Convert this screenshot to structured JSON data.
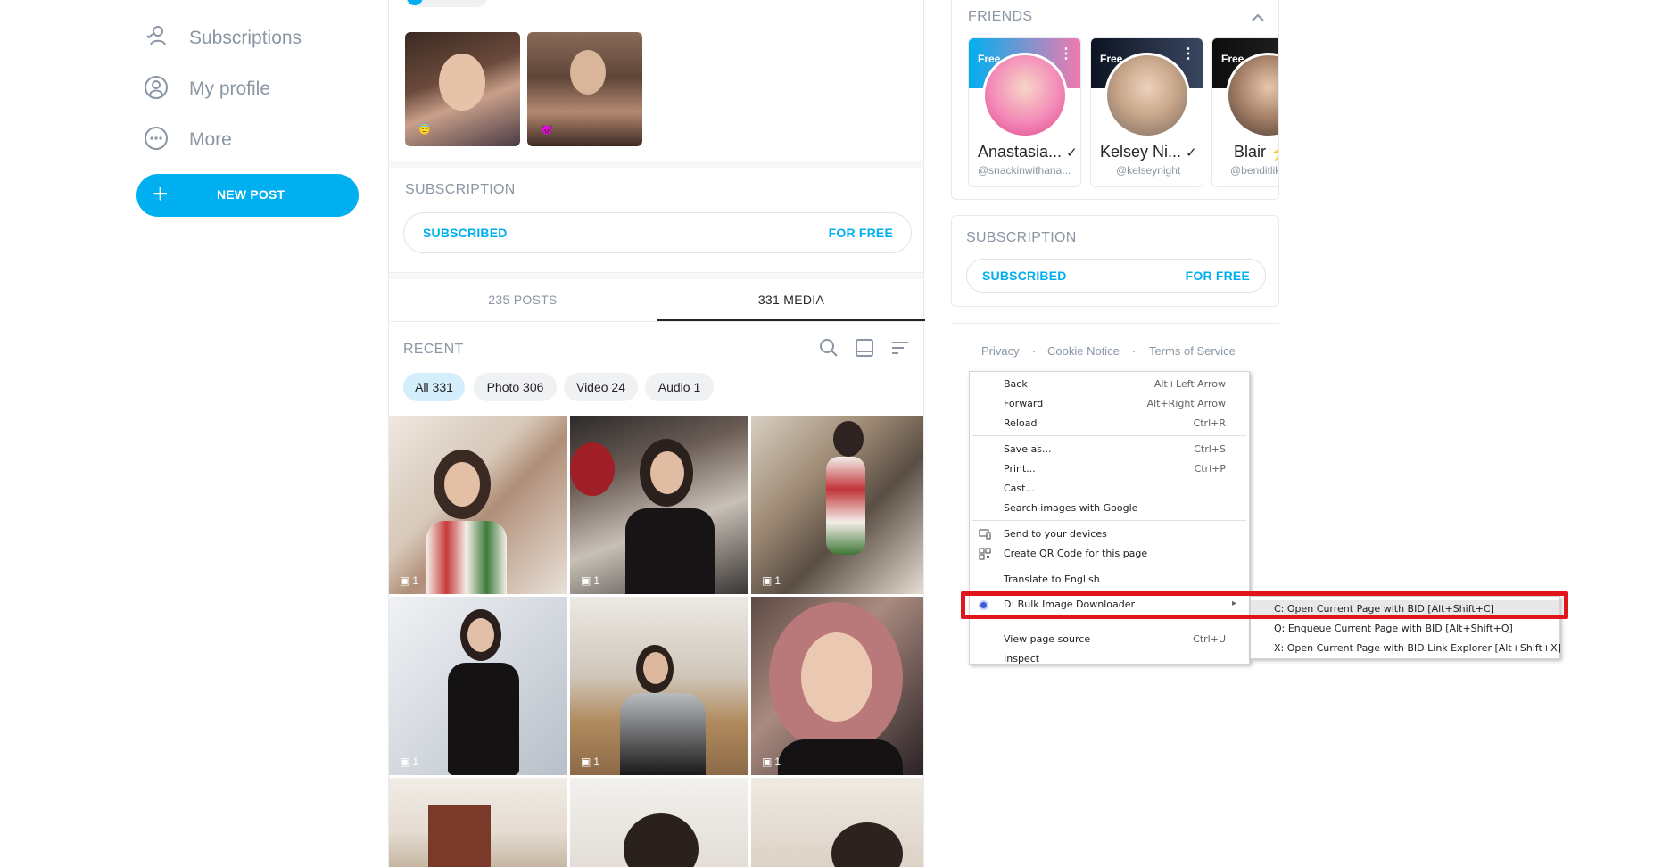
{
  "left_nav": {
    "items": [
      {
        "label": "Subscriptions",
        "icon": "subscriptions-icon"
      },
      {
        "label": "My profile",
        "icon": "profile-icon"
      },
      {
        "label": "More",
        "icon": "more-icon"
      }
    ],
    "new_post_label": "NEW POST"
  },
  "center": {
    "subscription": {
      "title": "SUBSCRIPTION",
      "status": "SUBSCRIBED",
      "price": "FOR FREE"
    },
    "tabs": [
      {
        "label": "235 POSTS",
        "active": false
      },
      {
        "label": "331 MEDIA",
        "active": true
      }
    ],
    "recent_label": "RECENT",
    "filters": [
      {
        "label": "All 331",
        "active": true
      },
      {
        "label": "Photo 306",
        "active": false
      },
      {
        "label": "Video 24",
        "active": false
      },
      {
        "label": "Audio 1",
        "active": false
      }
    ],
    "highlight_badges": [
      "😇",
      "😈"
    ],
    "media_counts": [
      "1",
      "1",
      "1",
      "1",
      "1",
      "1"
    ]
  },
  "right": {
    "friends_title": "FRIENDS",
    "friends": [
      {
        "name": "Anastasia...",
        "handle": "@snackinwithana...",
        "badge": "Free"
      },
      {
        "name": "Kelsey Ni...",
        "handle": "@kelseynight",
        "badge": "Free"
      },
      {
        "name": "Blair",
        "handle": "@benditlike",
        "badge": "Free"
      }
    ],
    "subscription": {
      "title": "SUBSCRIPTION",
      "status": "SUBSCRIBED",
      "price": "FOR FREE"
    },
    "footer": [
      "Privacy",
      "Cookie Notice",
      "Terms of Service"
    ],
    "footer_sep": "·"
  },
  "context_menu": {
    "items": [
      {
        "label": "Back",
        "shortcut": "Alt+Left Arrow"
      },
      {
        "label": "Forward",
        "shortcut": "Alt+Right Arrow"
      },
      {
        "label": "Reload",
        "shortcut": "Ctrl+R"
      },
      {
        "label": "Save as...",
        "shortcut": "Ctrl+S"
      },
      {
        "label": "Print...",
        "shortcut": "Ctrl+P"
      },
      {
        "label": "Cast...",
        "shortcut": ""
      },
      {
        "label": "Search images with Google",
        "shortcut": ""
      },
      {
        "label": "Send to your devices",
        "shortcut": ""
      },
      {
        "label": "Create QR Code for this page",
        "shortcut": ""
      },
      {
        "label": "Translate to English",
        "shortcut": ""
      },
      {
        "label": "D: Bulk Image Downloader",
        "shortcut": ""
      },
      {
        "label": "View page source",
        "shortcut": "Ctrl+U"
      },
      {
        "label": "Inspect",
        "shortcut": ""
      }
    ],
    "submenu_arrow": "▸",
    "submenu": [
      "C: Open Current Page with BID  [Alt+Shift+C]",
      "Q: Enqueue Current Page with BID  [Alt+Shift+Q]",
      "X: Open Current Page with BID Link Explorer  [Alt+Shift+X]"
    ]
  },
  "colors": {
    "accent": "#00aff0",
    "muted": "#8a96a3",
    "highlight": "#e0161c"
  }
}
